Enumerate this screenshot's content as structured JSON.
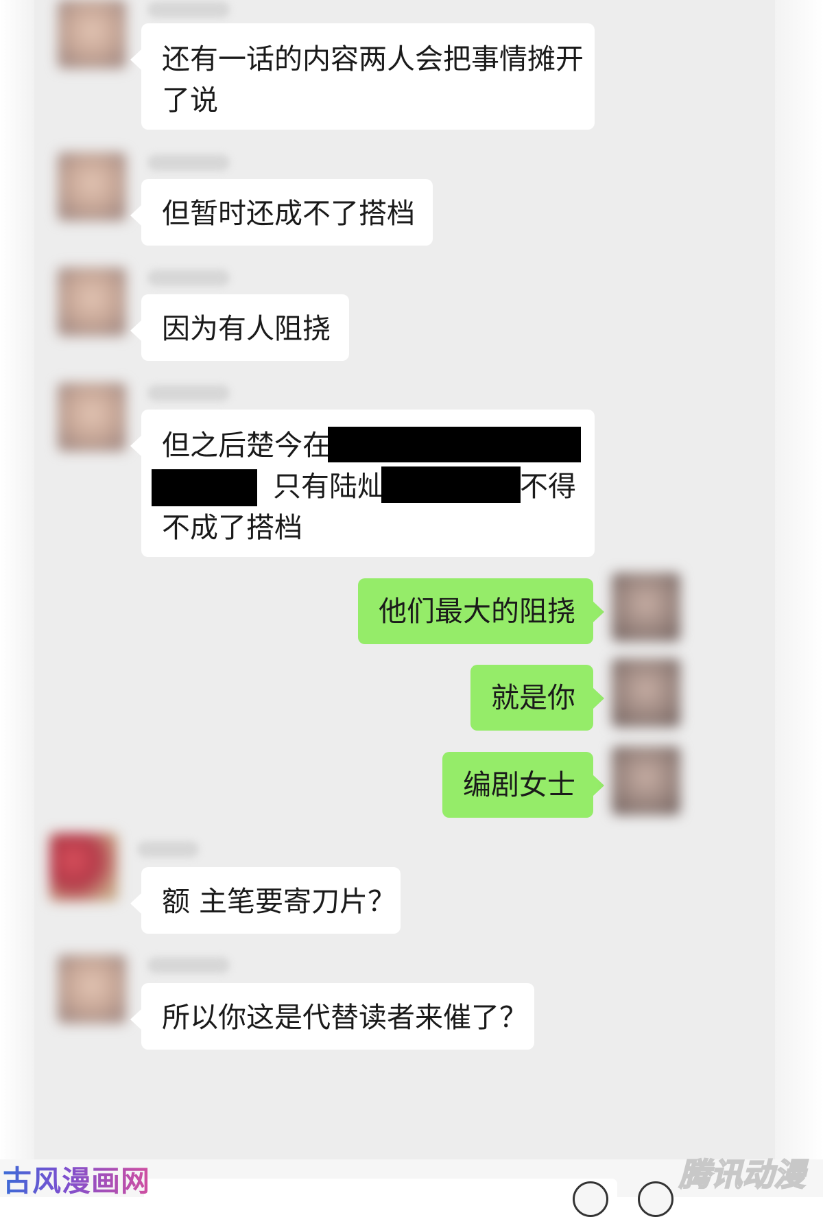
{
  "messages": [
    {
      "side": "incoming",
      "lines": [
        "还有一话的内容两人会把事情摊开",
        "了说"
      ]
    },
    {
      "side": "incoming",
      "text": "但暂时还成不了搭档"
    },
    {
      "side": "incoming",
      "text": "因为有人阻挠"
    },
    {
      "side": "incoming",
      "lines": [
        "但之后楚今在",
        "只有陆灿",
        "不得",
        "不成了搭档"
      ]
    },
    {
      "side": "outgoing",
      "text": "他们最大的阻挠"
    },
    {
      "side": "outgoing",
      "text": "就是你"
    },
    {
      "side": "outgoing",
      "text": "编剧女士"
    },
    {
      "side": "incoming",
      "text": "额 主笔要寄刀片？"
    },
    {
      "side": "incoming",
      "text": "所以你这是代替读者来催了？"
    }
  ],
  "watermarks": {
    "left": "古风漫画网",
    "right": "腾讯动漫"
  },
  "colors": {
    "chat_background": "#ededed",
    "incoming_bubble": "#ffffff",
    "outgoing_bubble": "#95ec69",
    "redaction": "#000000"
  }
}
